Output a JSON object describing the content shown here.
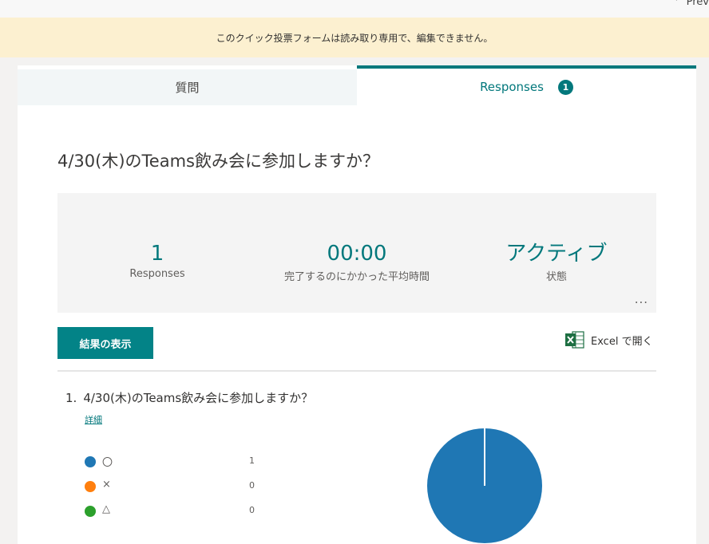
{
  "window": {
    "preview_label": "Prev"
  },
  "banner": {
    "text": "このクイック投票フォームは読み取り専用で、編集できません。"
  },
  "tabs": {
    "questions": "質問",
    "responses": "Responses",
    "responses_count": "1"
  },
  "form": {
    "title": "4/30(木)のTeams飲み会に参加しますか？"
  },
  "summary": {
    "responses_value": "1",
    "responses_label": "Responses",
    "avg_time_value": "00:00",
    "avg_time_label": "完了するのにかかった平均時間",
    "status_value": "アクティブ",
    "status_label": "状態",
    "more": "..."
  },
  "actions": {
    "view_results": "結果の表示",
    "open_excel": "Excel で開く"
  },
  "question": {
    "number": "1.",
    "title": "4/30(木)のTeams飲み会に参加しますか？",
    "details_link": "詳細",
    "options": [
      {
        "label": "〇",
        "count": "1",
        "color": "#1f77b4"
      },
      {
        "label": "×",
        "count": "0",
        "color": "#ff7f0e"
      },
      {
        "label": "△",
        "count": "0",
        "color": "#2ca02c"
      }
    ]
  },
  "chart_data": {
    "type": "pie",
    "categories": [
      "〇",
      "×",
      "△"
    ],
    "values": [
      1,
      0,
      0
    ],
    "colors": [
      "#1f77b4",
      "#ff7f0e",
      "#2ca02c"
    ]
  }
}
